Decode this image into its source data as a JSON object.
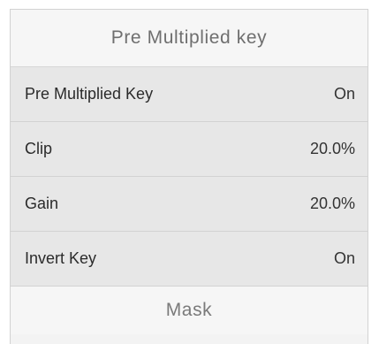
{
  "panel": {
    "title": "Pre Multiplied key",
    "footer_label": "Mask",
    "rows": [
      {
        "label": "Pre Multiplied Key",
        "value": "On"
      },
      {
        "label": "Clip",
        "value": "20.0%"
      },
      {
        "label": "Gain",
        "value": "20.0%"
      },
      {
        "label": "Invert Key",
        "value": "On"
      }
    ]
  }
}
